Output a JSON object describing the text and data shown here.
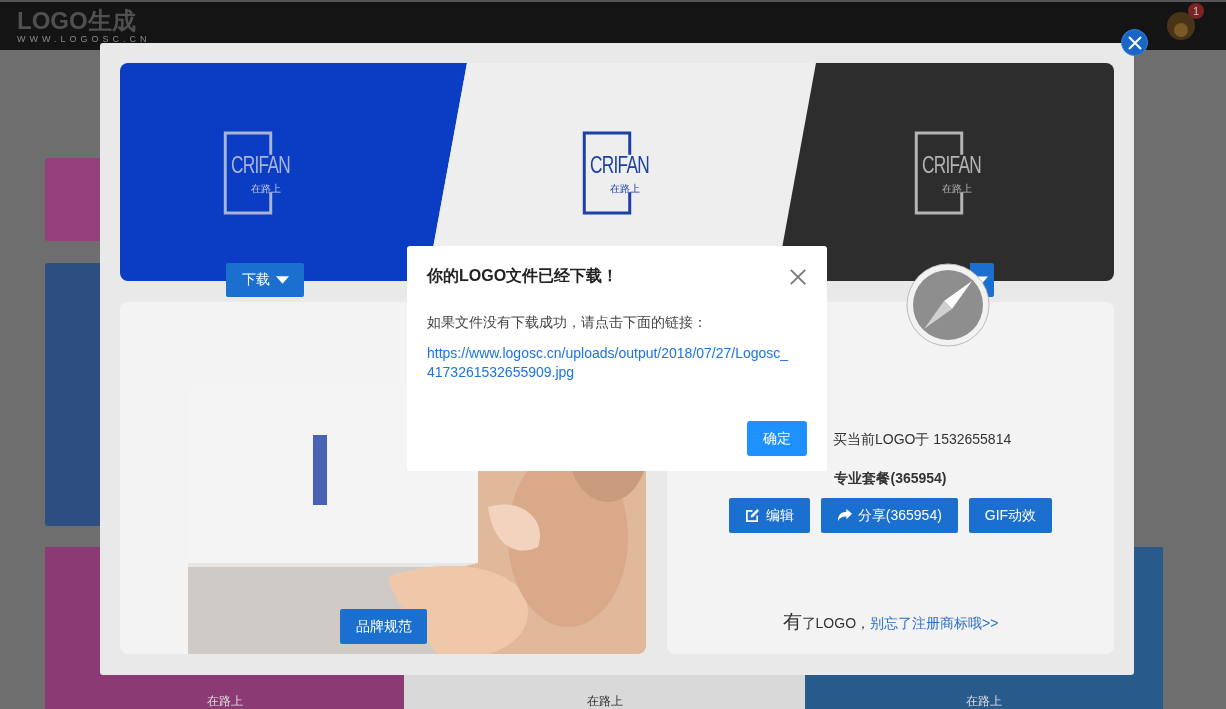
{
  "header": {
    "logo": "LOGO生成",
    "logo_url": "WWW.LOGOSC.CN",
    "notification_count": "1"
  },
  "side_cards": [
    {
      "color": "#94407c"
    },
    {
      "color": "#2c4e80"
    }
  ],
  "bottom_cards": [
    {
      "color": "#8c3a74",
      "tagline": "在路上"
    },
    {
      "color": "#d9d9d9",
      "tagline": "在路上"
    },
    {
      "color": "#285a8c",
      "tagline": "在路上"
    }
  ],
  "banner": [
    {
      "kind": "blue",
      "logo_text": "CRIFAN",
      "tagline": "在路上",
      "has_button": true,
      "button_label": "下载"
    },
    {
      "kind": "light",
      "logo_text": "CRIFAN",
      "tagline": "在路上",
      "has_button": false
    },
    {
      "kind": "dark",
      "logo_text": "CRIFAN",
      "tagline": "在路上",
      "has_button": true
    }
  ],
  "mockup": {
    "kind": "picture",
    "button": "品牌规范"
  },
  "purchase": {
    "note": "买当前LOGO于 1532655814",
    "plan": "专业套餐(365954)",
    "actions": [
      {
        "kind": "edit",
        "label": "编辑"
      },
      {
        "kind": "share",
        "label": "分享(365954)"
      },
      {
        "kind": "plain",
        "label": "GIF动效"
      }
    ],
    "footer_text": "有了LOGO，",
    "footer_link": "别忘了注册商标哦>>"
  },
  "dialog": {
    "title": "你的LOGO文件已经下载！",
    "message": "如果文件没有下载成功，请点击下面的链接：",
    "link": "https://www.logosc.cn/uploads/output/2018/07/27/Logosc_4173261532655909.jpg",
    "confirm": "确定"
  }
}
